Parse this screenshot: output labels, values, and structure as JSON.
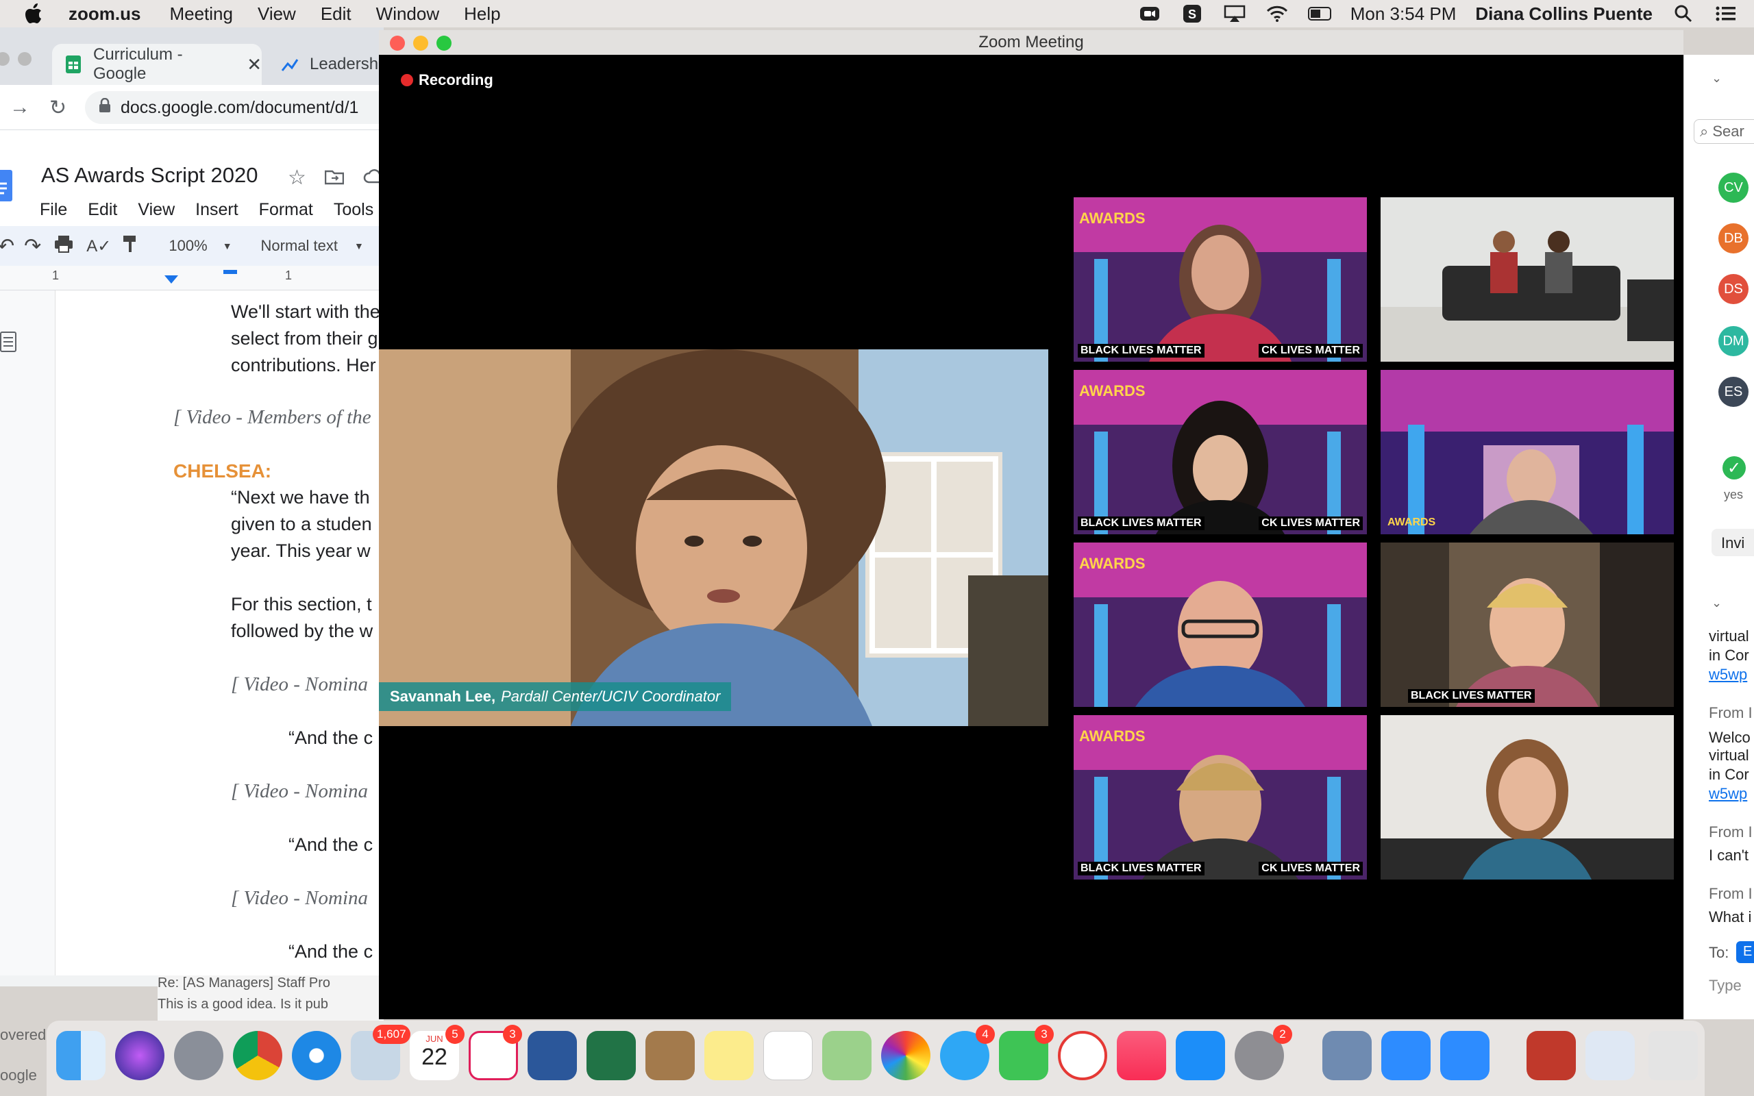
{
  "menubar": {
    "app_name": "zoom.us",
    "menus": [
      "Meeting",
      "View",
      "Edit",
      "Window",
      "Help"
    ],
    "clock": "Mon 3:54 PM",
    "user": "Diana Collins Puente"
  },
  "chrome": {
    "tabs": [
      {
        "title": "Curriculum - Google"
      },
      {
        "title": "Leadershi"
      }
    ],
    "url": "docs.google.com/document/d/1"
  },
  "docs": {
    "title": "AS Awards Script 2020",
    "menus": [
      "File",
      "Edit",
      "View",
      "Insert",
      "Format",
      "Tools"
    ],
    "zoom": "100%",
    "style": "Normal text",
    "ruler_marks": [
      "1",
      "1"
    ],
    "lines": [
      "We'll start with the",
      "select from their g",
      "contributions. Her",
      "[ Video - Members of the",
      "CHELSEA:",
      "“Next we have th",
      "given to a studen",
      "year. This year w",
      "For this section, t",
      "followed by the w",
      "[ Video - Nomina",
      "“And the c",
      "[ Video - Nomina",
      "“And the c",
      "[ Video - Nomina",
      "“And the c"
    ],
    "email_preview": [
      "Re: [AS Managers] Staff Pro",
      "This is a good idea. Is it pub"
    ],
    "left_clip": [
      "overed",
      "oogle"
    ]
  },
  "zoom": {
    "window_title": "Zoom Meeting",
    "recording_label": "Recording",
    "speaker_name": "Savannah Lee,",
    "speaker_role": "Pardall Center/UCIV Coordinator",
    "tile_banner_left": "BLACK LIVES MATTER",
    "tile_banner_right": "CK LIVES MATTER",
    "awards_label": "AWARDS",
    "participants": [
      "CV",
      "DB",
      "DS",
      "DM",
      "ES"
    ],
    "participant_colors": [
      "#2db855",
      "#e8712c",
      "#e14f3c",
      "#2db8a0",
      "#3c4757"
    ],
    "yes_label": "yes",
    "invite_label": "Invi",
    "search_placeholder": "Sear",
    "chat": {
      "lines": [
        {
          "text": "virtual",
          "type": "text"
        },
        {
          "text": "in Cor",
          "type": "text"
        },
        {
          "text": "w5wp",
          "type": "link"
        },
        {
          "text": "From I",
          "type": "from"
        },
        {
          "text": "Welco",
          "type": "text"
        },
        {
          "text": "virtual",
          "type": "text"
        },
        {
          "text": "in Cor",
          "type": "text"
        },
        {
          "text": "w5wp",
          "type": "link"
        },
        {
          "text": "From I",
          "type": "from"
        },
        {
          "text": "I can't",
          "type": "text"
        },
        {
          "text": "From I",
          "type": "from"
        },
        {
          "text": "What i",
          "type": "text"
        }
      ],
      "to_label": "To:",
      "to_value": "E",
      "input_placeholder": "Type"
    }
  },
  "dock": {
    "badges": {
      "mail": "1,607",
      "calendar": "5",
      "slack": "3",
      "messages": "4",
      "facetime": "3",
      "settings": "2"
    },
    "calendar_month": "JUN",
    "calendar_day": "22"
  }
}
